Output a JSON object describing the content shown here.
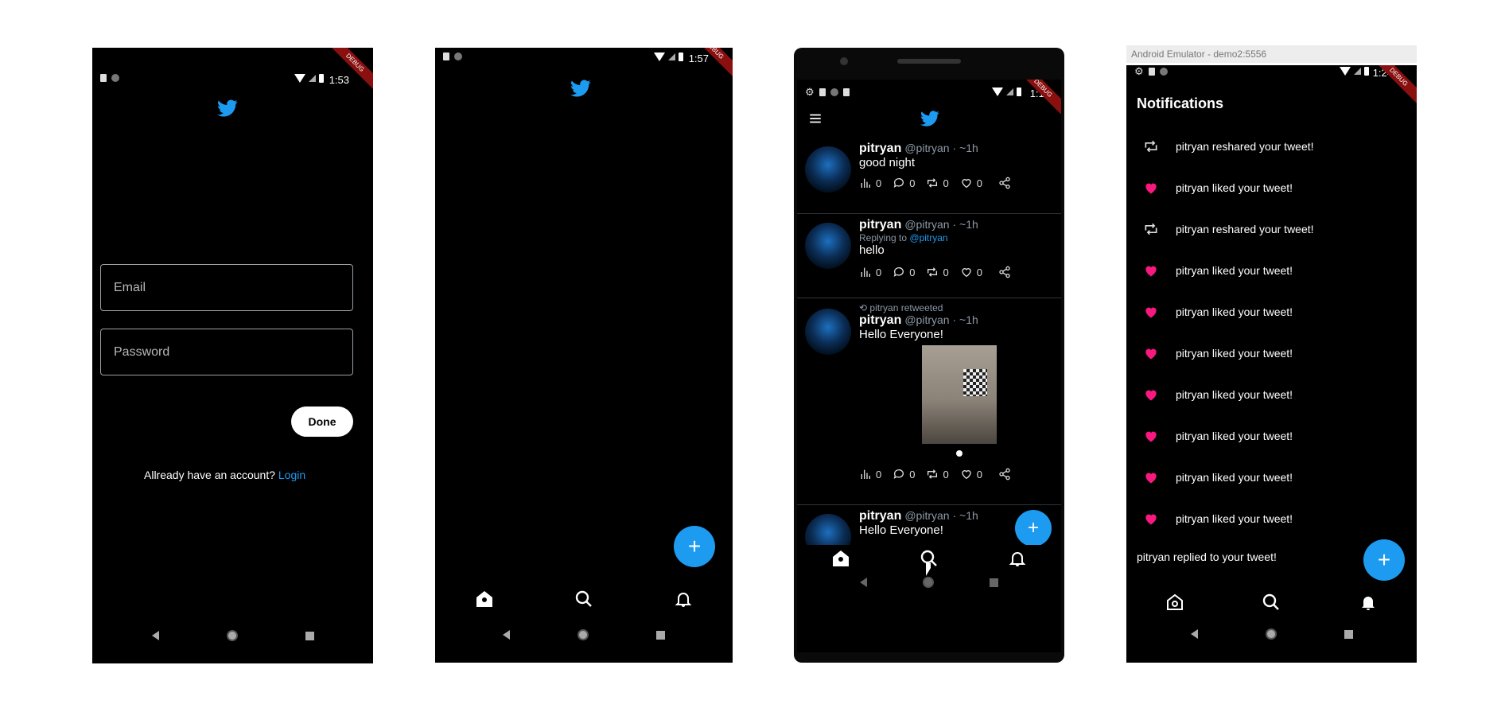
{
  "colors": {
    "accent": "#1d9bf0",
    "heart": "#f91880",
    "background": "#000000"
  },
  "screen1": {
    "status_time": "1:53",
    "banner": "DEBUG",
    "email_placeholder": "Email",
    "password_placeholder": "Password",
    "done_label": "Done",
    "account_prompt": "Allready have an account?",
    "login_link": "Login"
  },
  "screen2": {
    "status_time": "1:57",
    "banner": "DEBUG",
    "fab_label": "+"
  },
  "screen3": {
    "status_time": "1:13",
    "banner": "DEBUG",
    "tweets": [
      {
        "name": "pitryan",
        "meta": "@pitryan · ~1h",
        "text": "good night",
        "views": "0",
        "replies": "0",
        "retweets": "0",
        "likes": "0"
      },
      {
        "name": "pitryan",
        "meta": "@pitryan · ~1h",
        "reply_prefix": "Replying to",
        "reply_handle": "@pitryan",
        "text": "hello",
        "views": "0",
        "replies": "0",
        "retweets": "0",
        "likes": "0"
      },
      {
        "retweet_label": "pitryan retweeted",
        "name": "pitryan",
        "meta": "@pitryan · ~1h",
        "text": "Hello Everyone!",
        "views": "0",
        "replies": "0",
        "retweets": "0",
        "likes": "0"
      },
      {
        "name": "pitryan",
        "meta": "@pitryan · ~1h",
        "text": "Hello Everyone!"
      }
    ],
    "fab_label": "+"
  },
  "screen4": {
    "emulator_title": "Android Emulator - demo2:5556",
    "status_time": "1:24",
    "banner": "DEBUG",
    "page_title": "Notifications",
    "notifications": [
      {
        "icon": "retweet-icon",
        "text": "pitryan reshared your tweet!"
      },
      {
        "icon": "heart-icon",
        "text": "pitryan liked your tweet!"
      },
      {
        "icon": "retweet-icon",
        "text": "pitryan reshared your tweet!"
      },
      {
        "icon": "heart-icon",
        "text": "pitryan liked your tweet!"
      },
      {
        "icon": "heart-icon",
        "text": "pitryan liked your tweet!"
      },
      {
        "icon": "heart-icon",
        "text": "pitryan liked your tweet!"
      },
      {
        "icon": "heart-icon",
        "text": "pitryan liked your tweet!"
      },
      {
        "icon": "heart-icon",
        "text": "pitryan liked your tweet!"
      },
      {
        "icon": "heart-icon",
        "text": "pitryan liked your tweet!"
      },
      {
        "icon": "heart-icon",
        "text": "pitryan liked your tweet!"
      }
    ],
    "last_notification": "pitryan replied to your tweet!",
    "fab_label": "+"
  }
}
